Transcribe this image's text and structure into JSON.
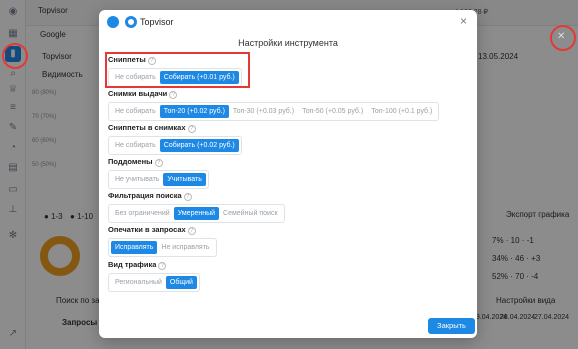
{
  "app": {
    "brand": "Topvisor",
    "balance": "4 136.78 ₽",
    "project": "Google",
    "date": "13.05.2024"
  },
  "background": {
    "tab_visibility": "Видимость",
    "sidebar_label": "Topvisor",
    "legend": [
      "1-3",
      "1-10"
    ],
    "export_label": "Экспорт графика",
    "search_placeholder": "Поиск по за",
    "view_settings": "Настройки вида",
    "queries_label": "Запросы",
    "dates": [
      "29.04.2024",
      "28.04.2024",
      "27.04.2024"
    ],
    "stats": [
      {
        "pct": "7%",
        "n": "10",
        "d": "-1"
      },
      {
        "pct": "34%",
        "n": "46",
        "d": "+3"
      },
      {
        "pct": "52%",
        "n": "70",
        "d": "-4"
      }
    ],
    "y_ticks": [
      "50 (50%)",
      "60 (60%)",
      "70 (70%)",
      "80 (80%)"
    ]
  },
  "modal": {
    "brand": "Topvisor",
    "title": "Настройки инструмента",
    "close_icon": "×",
    "sections": [
      {
        "label": "Сниппеты",
        "options": [
          "Не собирать",
          "Собирать (+0.01 руб.)"
        ],
        "selected": 1
      },
      {
        "label": "Снимки выдачи",
        "options": [
          "Не собирать",
          "Топ-20 (+0.02 руб.)",
          "Топ-30 (+0.03 руб.)",
          "Топ-50 (+0.05 руб.)",
          "Топ-100 (+0.1 руб.)"
        ],
        "selected": 1
      },
      {
        "label": "Сниппеты в снимках",
        "options": [
          "Не собирать",
          "Собирать (+0.02 руб.)"
        ],
        "selected": 1
      },
      {
        "label": "Поддомены",
        "options": [
          "Не учитывать",
          "Учитывать"
        ],
        "selected": 1
      },
      {
        "label": "Фильтрация поиска",
        "options": [
          "Без ограничений",
          "Умеренный",
          "Семейный поиск"
        ],
        "selected": 1
      },
      {
        "label": "Опечатки в запросах",
        "options": [
          "Исправлять",
          "Не исправлять"
        ],
        "selected": 0
      },
      {
        "label": "Вид трафика",
        "options": [
          "Региональный",
          "Общий"
        ],
        "selected": 1
      }
    ],
    "close_button": "Закрыть"
  },
  "colors": {
    "accent": "#1e88e5",
    "highlight": "#e53935"
  }
}
